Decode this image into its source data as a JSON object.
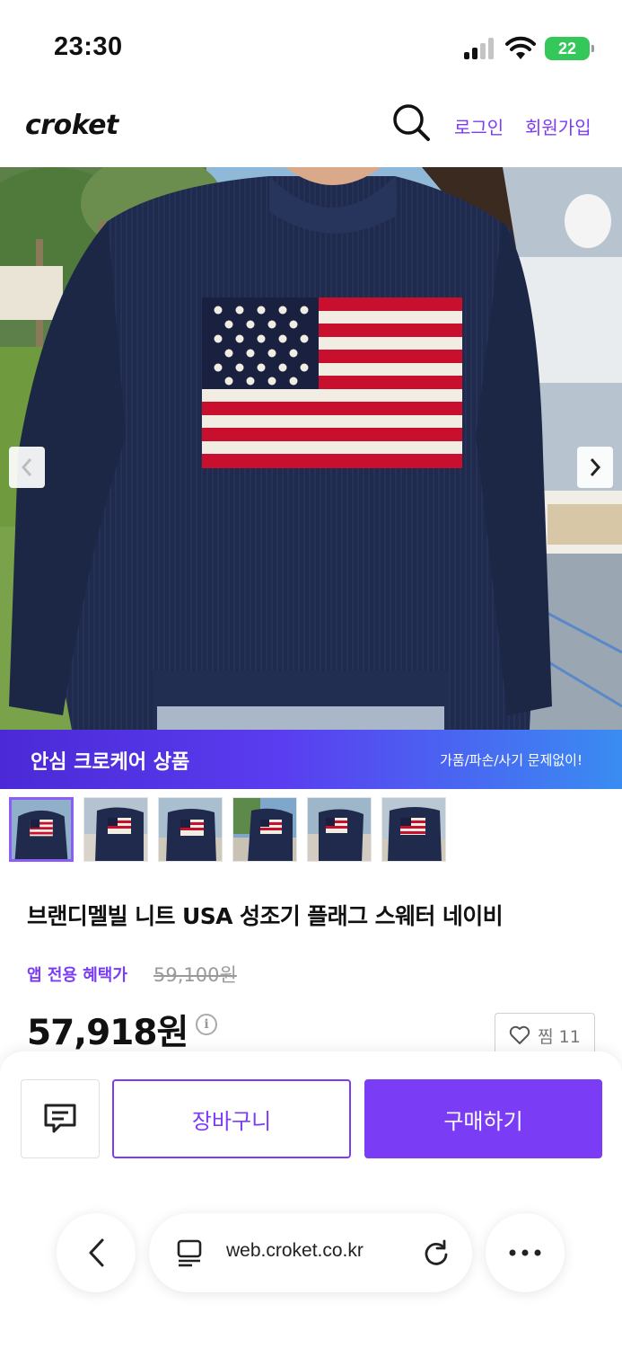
{
  "status_bar": {
    "time": "23:30",
    "battery": "22"
  },
  "header": {
    "logo": "croket",
    "login": "로그인",
    "signup": "회원가입"
  },
  "banner": {
    "title": "안심 크로케어 상품",
    "subtitle": "가품/파손/사기 문제없이!"
  },
  "product": {
    "title": "브랜디멜빌 니트 USA 성조기 플래그 스웨터 네이비",
    "promo_label": "앱 전용 혜택가",
    "original_price": "59,100원",
    "price": "57,918원",
    "wish_label": "찜 11"
  },
  "actions": {
    "cart": "장바구니",
    "buy": "구매하기"
  },
  "browser": {
    "url": "web.croket.co.kr"
  },
  "colors": {
    "accent": "#7b3cf5",
    "sweater": "#1f2a4d",
    "flag_red": "#c8102e"
  },
  "thumbnails": 6
}
